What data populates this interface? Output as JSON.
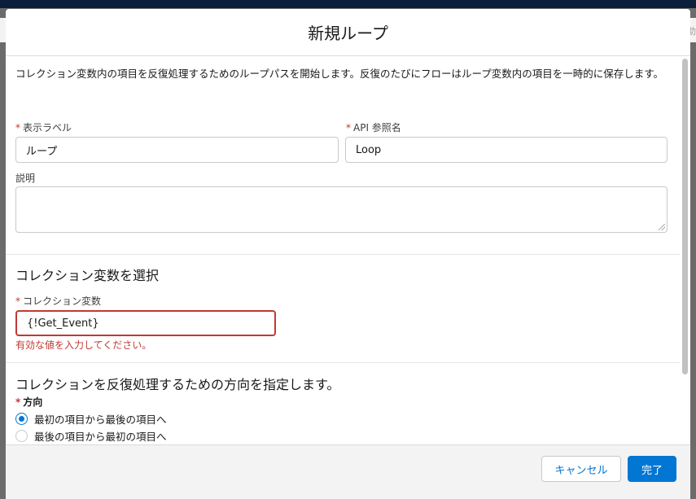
{
  "modal": {
    "title": "新規ループ",
    "intro": "コレクション変数内の項目を反復処理するためのループパスを開始します。反復のたびにフローはループ変数内の項目を一時的に保存します。"
  },
  "fields": {
    "label": {
      "label": "表示ラベル",
      "value": "ループ"
    },
    "api_name": {
      "label": "API 参照名",
      "value": "Loop"
    },
    "description": {
      "label": "説明",
      "value": ""
    }
  },
  "collection_section": {
    "title": "コレクション変数を選択",
    "field_label": "コレクション変数",
    "value": "{!Get_Event}",
    "error": "有効な値を入力してください。"
  },
  "direction_section": {
    "title": "コレクションを反復処理するための方向を指定します。",
    "label": "方向",
    "options": [
      {
        "label": "最初の項目から最後の項目へ",
        "checked": true
      },
      {
        "label": "最後の項目から最初の項目へ",
        "checked": false
      }
    ]
  },
  "footer": {
    "cancel_label": "キャンセル",
    "done_label": "完了"
  },
  "background": {
    "right_peek_text": "助"
  },
  "colors": {
    "brand": "#0176d3",
    "error": "#c23934",
    "header_band": "#0b1f3a"
  }
}
